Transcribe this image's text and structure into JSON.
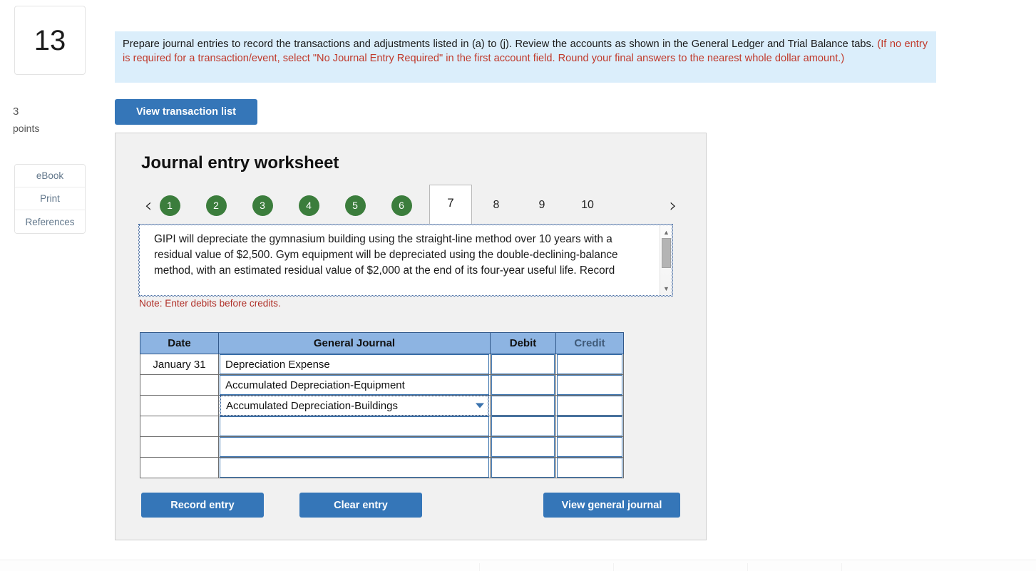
{
  "rail": {
    "question_number": "13",
    "points_value": "3",
    "points_label": "points",
    "tools": [
      {
        "label": "eBook"
      },
      {
        "label": "Print"
      },
      {
        "label": "References"
      }
    ]
  },
  "instruction": {
    "main": "Prepare journal entries to record the transactions and adjustments listed in (a) to (j). Review the accounts as shown in the General Ledger and Trial Balance tabs. ",
    "required": "(If no entry is required for a transaction/event, select \"No Journal Entry Required\" in the first account field. Round your final answers to the nearest whole dollar amount.)"
  },
  "toolbar": {
    "view_transaction_list": "View transaction list"
  },
  "worksheet": {
    "title": "Journal entry worksheet",
    "pager": {
      "prev_icon": "chevron-left-icon",
      "next_icon": "chevron-right-icon",
      "items": [
        {
          "label": "1",
          "state": "completed"
        },
        {
          "label": "2",
          "state": "completed"
        },
        {
          "label": "3",
          "state": "completed"
        },
        {
          "label": "4",
          "state": "completed"
        },
        {
          "label": "5",
          "state": "completed"
        },
        {
          "label": "6",
          "state": "completed"
        },
        {
          "label": "7",
          "state": "active"
        },
        {
          "label": "8",
          "state": "pending"
        },
        {
          "label": "9",
          "state": "pending"
        },
        {
          "label": "10",
          "state": "pending"
        }
      ]
    },
    "prompt": "GIPI will depreciate the gymnasium building using the straight-line method over 10 years with a residual value of $2,500. Gym equipment will be depreciated using the double-declining-balance method, with an estimated residual value of $2,000 at the end of its four-year useful life. Record",
    "note": "Note: Enter debits before credits.",
    "table": {
      "headers": {
        "date": "Date",
        "journal": "General Journal",
        "debit": "Debit",
        "credit": "Credit"
      },
      "rows": [
        {
          "date": "January 31",
          "account": "Depreciation Expense",
          "debit": "",
          "credit": "",
          "selected": false
        },
        {
          "date": "",
          "account": "Accumulated Depreciation-Equipment",
          "debit": "",
          "credit": "",
          "selected": false
        },
        {
          "date": "",
          "account": "Accumulated Depreciation-Buildings",
          "debit": "",
          "credit": "",
          "selected": true
        },
        {
          "date": "",
          "account": "",
          "debit": "",
          "credit": "",
          "selected": false
        },
        {
          "date": "",
          "account": "",
          "debit": "",
          "credit": "",
          "selected": false
        },
        {
          "date": "",
          "account": "",
          "debit": "",
          "credit": "",
          "selected": false
        }
      ]
    },
    "actions": {
      "record_entry": "Record entry",
      "clear_entry": "Clear entry",
      "view_general_journal": "View general journal"
    }
  },
  "colors": {
    "accent_blue": "#3576b8",
    "completed_green": "#3b7d3c",
    "banner_blue": "#dbeefb",
    "required_red": "#c0392b",
    "table_header": "#8db4e2",
    "field_border": "#3a72ad"
  }
}
